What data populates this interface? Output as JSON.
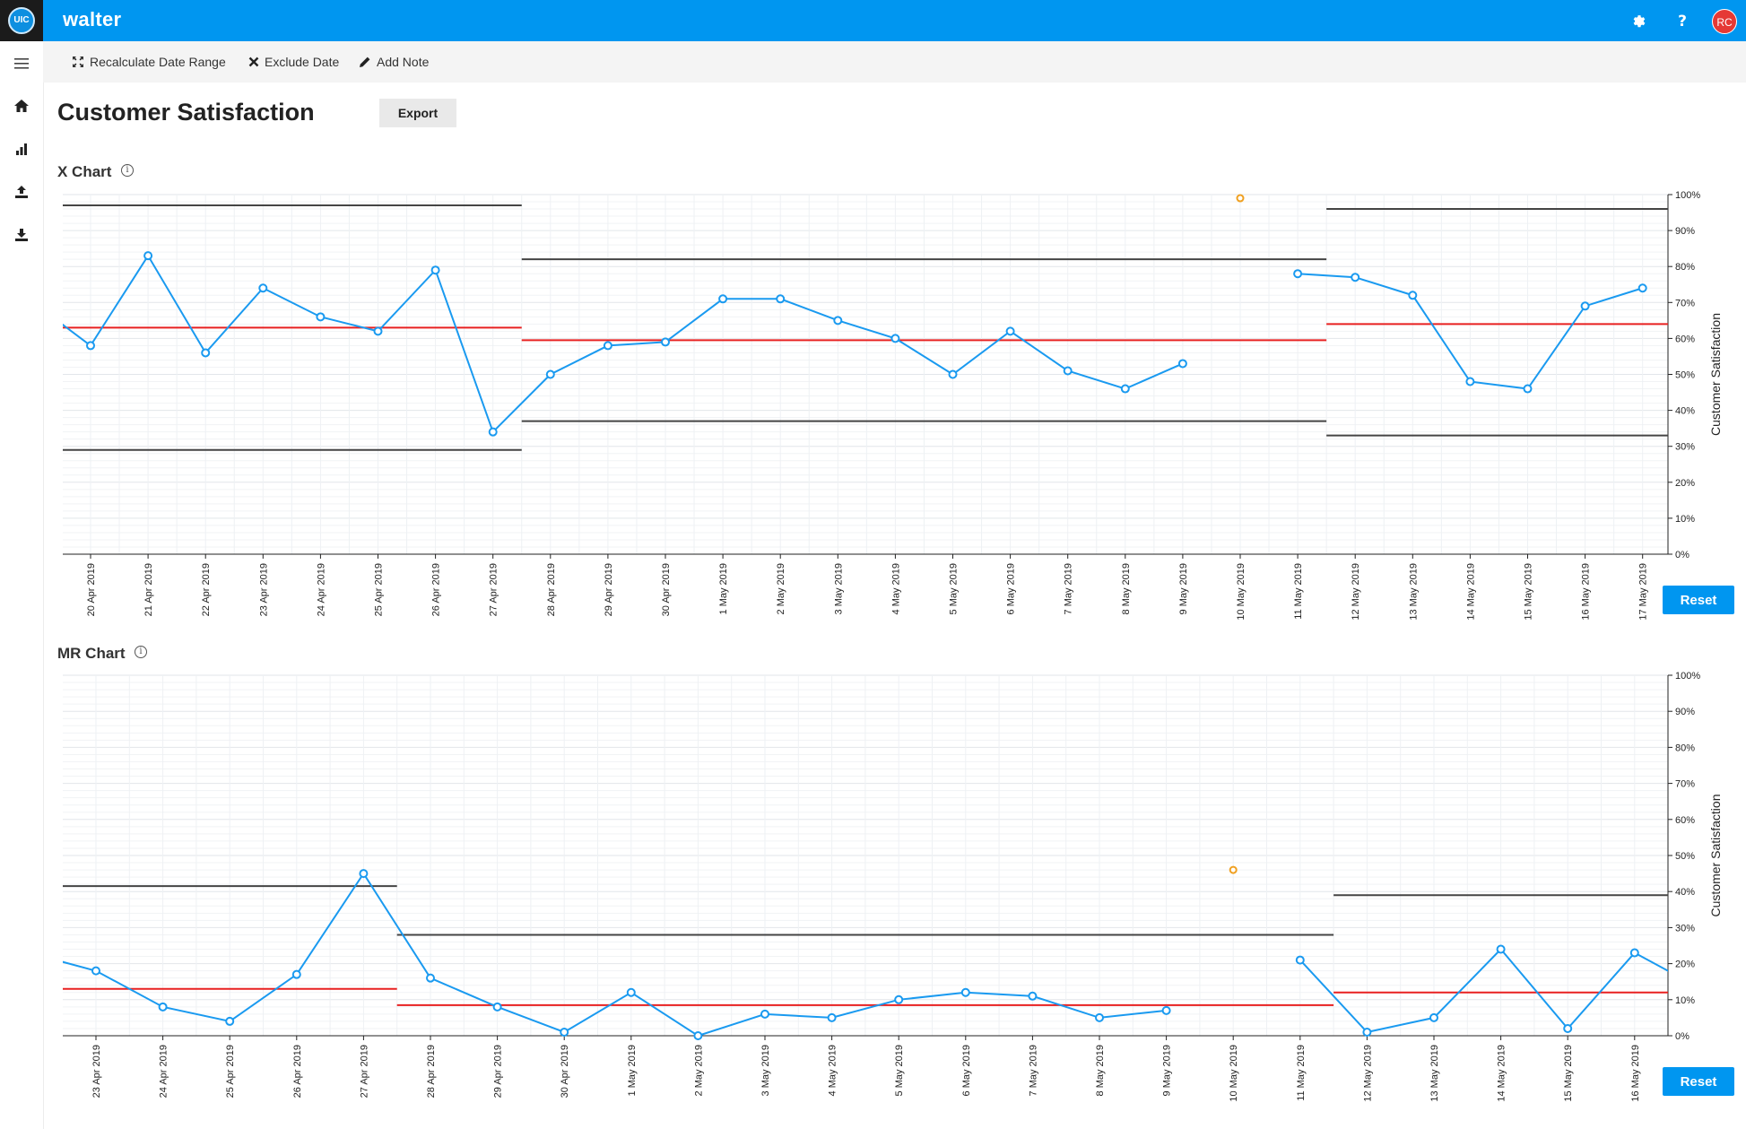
{
  "app": {
    "logo_text": "UIC",
    "name": "walter",
    "avatar_initials": "RC"
  },
  "toolbar": {
    "recalculate_label": "Recalculate Date Range",
    "exclude_label": "Exclude Date",
    "add_note_label": "Add Note"
  },
  "page": {
    "title": "Customer Satisfaction",
    "export_label": "Export"
  },
  "x_section": {
    "title": "X Chart",
    "reset_label": "Reset"
  },
  "mr_section": {
    "title": "MR Chart",
    "reset_label": "Reset"
  },
  "colors": {
    "brand": "#0096f0",
    "series": "#1a9af0",
    "center": "#e82020",
    "limit": "#444444",
    "excluded": "#f0a020"
  },
  "chart_data": [
    {
      "type": "line",
      "title": "X Chart",
      "ylabel": "Customer Satisfaction",
      "ylim": [
        0,
        100
      ],
      "yticks": [
        "0%",
        "10%",
        "20%",
        "30%",
        "40%",
        "50%",
        "60%",
        "70%",
        "80%",
        "90%",
        "100%"
      ],
      "categories": [
        "20 Apr 2019",
        "21 Apr 2019",
        "22 Apr 2019",
        "23 Apr 2019",
        "24 Apr 2019",
        "25 Apr 2019",
        "26 Apr 2019",
        "27 Apr 2019",
        "28 Apr 2019",
        "29 Apr 2019",
        "30 Apr 2019",
        "1 May 2019",
        "2 May 2019",
        "3 May 2019",
        "4 May 2019",
        "5 May 2019",
        "6 May 2019",
        "7 May 2019",
        "8 May 2019",
        "9 May 2019",
        "10 May 2019",
        "11 May 2019",
        "12 May 2019",
        "13 May 2019",
        "14 May 2019",
        "15 May 2019",
        "16 May 2019",
        "17 May 2019"
      ],
      "values": [
        58,
        83,
        56,
        74,
        66,
        62,
        79,
        34,
        50,
        58,
        59,
        71,
        71,
        65,
        60,
        50,
        62,
        51,
        46,
        53,
        null,
        78,
        77,
        72,
        48,
        46,
        69,
        74
      ],
      "excluded": [
        {
          "category": "10 May 2019",
          "value": 99
        }
      ],
      "offscreen_left_value": 70,
      "periods": [
        {
          "from": "20 Apr 2019",
          "to": "27 Apr 2019",
          "center": 63,
          "ucl": 97,
          "lcl": 29
        },
        {
          "from": "28 Apr 2019",
          "to": "11 May 2019",
          "center": 59.5,
          "ucl": 82,
          "lcl": 37
        },
        {
          "from": "12 May 2019",
          "to": "17 May 2019",
          "center": 64,
          "ucl": 96,
          "lcl": 33
        }
      ]
    },
    {
      "type": "line",
      "title": "MR Chart",
      "ylabel": "Customer Satisfaction",
      "ylim": [
        0,
        100
      ],
      "yticks": [
        "0%",
        "10%",
        "20%",
        "30%",
        "40%",
        "50%",
        "60%",
        "70%",
        "80%",
        "90%",
        "100%"
      ],
      "categories": [
        "23 Apr 2019",
        "24 Apr 2019",
        "25 Apr 2019",
        "26 Apr 2019",
        "27 Apr 2019",
        "28 Apr 2019",
        "29 Apr 2019",
        "30 Apr 2019",
        "1 May 2019",
        "2 May 2019",
        "3 May 2019",
        "4 May 2019",
        "5 May 2019",
        "6 May 2019",
        "7 May 2019",
        "8 May 2019",
        "9 May 2019",
        "10 May 2019",
        "11 May 2019",
        "12 May 2019",
        "13 May 2019",
        "14 May 2019",
        "15 May 2019",
        "16 May 2019"
      ],
      "values": [
        18,
        8,
        4,
        17,
        45,
        16,
        8,
        1,
        12,
        0,
        6,
        5,
        10,
        12,
        11,
        5,
        7,
        null,
        21,
        1,
        5,
        24,
        2,
        23
      ],
      "excluded": [
        {
          "category": "10 May 2019",
          "value": 46
        }
      ],
      "offscreen_left_value": 23,
      "offscreen_right_value": 13,
      "periods": [
        {
          "from": "23 Apr 2019",
          "to": "27 Apr 2019",
          "center": 13,
          "ucl": 41.5
        },
        {
          "from": "28 Apr 2019",
          "to": "11 May 2019",
          "center": 8.5,
          "ucl": 28
        },
        {
          "from": "12 May 2019",
          "to": "16 May 2019",
          "center": 12,
          "ucl": 39
        }
      ]
    }
  ]
}
